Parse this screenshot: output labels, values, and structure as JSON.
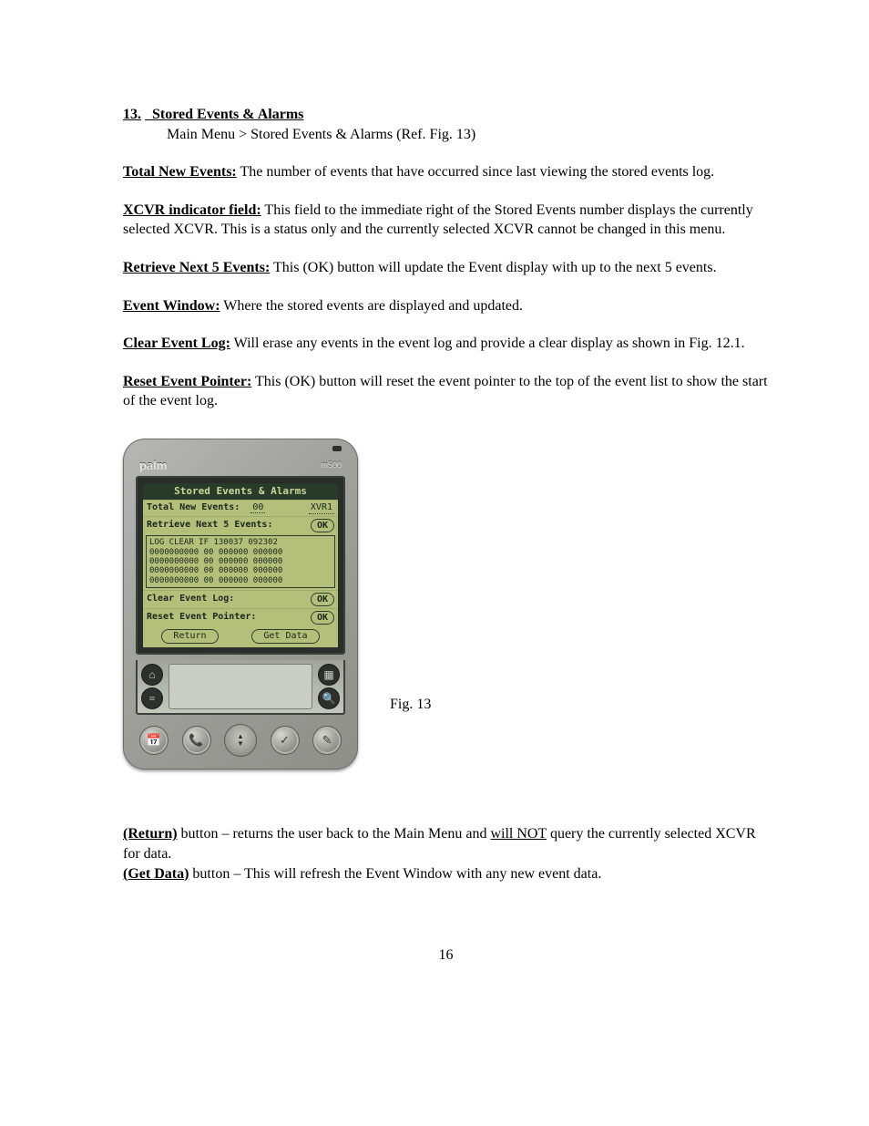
{
  "section": {
    "number": "13.",
    "title": "Stored Events & Alarms",
    "breadcrumb": "Main Menu > Stored Events & Alarms   (Ref. Fig. 13)"
  },
  "definitions": {
    "total_new_events": {
      "label": "Total New Events:",
      "text": "  The number of events that have occurred since last viewing the stored events log."
    },
    "xcvr_indicator": {
      "label": "XCVR indicator field:",
      "text": "  This field to the immediate right of the Stored Events number displays the currently selected XCVR.  This is a status only and the currently selected XCVR cannot be changed in this menu."
    },
    "retrieve_next5": {
      "label": "Retrieve Next 5 Events:",
      "text": "  This (OK) button will update the Event display with up to the next 5 events."
    },
    "event_window": {
      "label": "Event Window:",
      "text": "  Where the stored events are displayed and updated."
    },
    "clear_event_log": {
      "label": "Clear Event Log:",
      "text": "  Will erase any events in the event log and provide a clear display as shown in Fig. 12.1."
    },
    "reset_event_pointer": {
      "label": "Reset Event Pointer:",
      "text": "  This (OK) button will reset the event pointer to the top of the event list to show the start of the event log."
    }
  },
  "figure": {
    "caption": "Fig. 13",
    "device": {
      "brand": "palm",
      "model": "m500",
      "screen": {
        "title": "Stored Events & Alarms",
        "row_total": {
          "label": "Total New Events:",
          "value": "00",
          "xcvr": "XVR1"
        },
        "row_retrieve": {
          "label": "Retrieve Next 5 Events:",
          "btn": "OK"
        },
        "log_lines": [
          "LOG CLEAR IF 130037 092302",
          "0000000000 00 000000 000000",
          "0000000000 00 000000 000000",
          "0000000000 00 000000 000000",
          "0000000000 00 000000 000000"
        ],
        "row_clear": {
          "label": "Clear Event Log:",
          "btn": "OK"
        },
        "row_reset": {
          "label": "Reset Event Pointer:",
          "btn": "OK"
        },
        "btn_return": "Return",
        "btn_getdata": "Get Data"
      }
    }
  },
  "footer_defs": {
    "return": {
      "label": "(Return)",
      "text_before": " button – returns the user back to the Main Menu and ",
      "will_not": "will NOT",
      "text_after": " query the currently selected XCVR for data."
    },
    "getdata": {
      "label": "(Get Data)",
      "text": " button – This will refresh the Event Window with any new event data."
    }
  },
  "page_number": "16"
}
